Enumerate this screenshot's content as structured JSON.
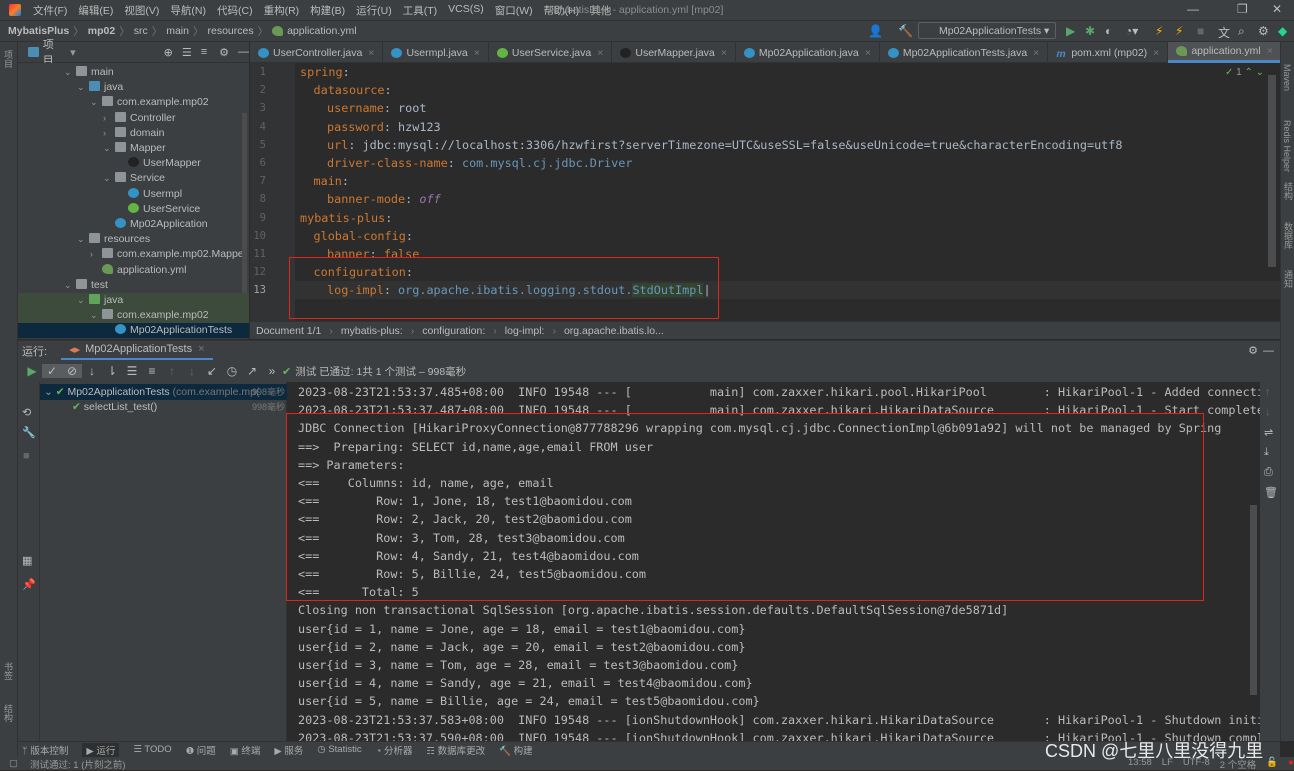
{
  "menubar": {
    "items": [
      "文件(F)",
      "编辑(E)",
      "视图(V)",
      "导航(N)",
      "代码(C)",
      "重构(R)",
      "构建(B)",
      "运行(U)",
      "工具(T)",
      "VCS(S)",
      "窗口(W)",
      "帮助(H)",
      "其他"
    ],
    "title": "MybatisPlus - application.yml [mp02]"
  },
  "navbar": {
    "crumbs": [
      "MybatisPlus",
      "mp02",
      "src",
      "main",
      "resources",
      "application.yml"
    ],
    "run_config": "Mp02ApplicationTests"
  },
  "project": {
    "title": "项目",
    "tree": [
      {
        "label": "main",
        "depth": 0,
        "arrow": "v",
        "icon": "folder"
      },
      {
        "label": "java",
        "depth": 1,
        "arrow": "v",
        "icon": "folderblue"
      },
      {
        "label": "com.example.mp02",
        "depth": 2,
        "arrow": "v",
        "icon": "folder"
      },
      {
        "label": "Controller",
        "depth": 3,
        "arrow": ">",
        "icon": "folder"
      },
      {
        "label": "domain",
        "depth": 3,
        "arrow": ">",
        "icon": "folder"
      },
      {
        "label": "Mapper",
        "depth": 3,
        "arrow": "v",
        "icon": "folder"
      },
      {
        "label": "UserMapper",
        "depth": 4,
        "arrow": "",
        "icon": "mapper"
      },
      {
        "label": "Service",
        "depth": 3,
        "arrow": "v",
        "icon": "folder"
      },
      {
        "label": "Usermpl",
        "depth": 4,
        "arrow": "",
        "icon": "cls"
      },
      {
        "label": "UserService",
        "depth": 4,
        "arrow": "",
        "icon": "intf"
      },
      {
        "label": "Mp02Application",
        "depth": 3,
        "arrow": "",
        "icon": "cls"
      },
      {
        "label": "resources",
        "depth": 1,
        "arrow": "v",
        "icon": "folder"
      },
      {
        "label": "com.example.mp02.Mapper",
        "depth": 2,
        "arrow": ">",
        "icon": "folder"
      },
      {
        "label": "application.yml",
        "depth": 2,
        "arrow": "",
        "icon": "yml"
      },
      {
        "label": "test",
        "depth": 0,
        "arrow": "v",
        "icon": "folder"
      },
      {
        "label": "java",
        "depth": 1,
        "arrow": "v",
        "icon": "foldergreen"
      },
      {
        "label": "com.example.mp02",
        "depth": 2,
        "arrow": "v",
        "icon": "folder"
      },
      {
        "label": "Mp02ApplicationTests",
        "depth": 3,
        "arrow": "",
        "icon": "cls",
        "selected": true
      }
    ]
  },
  "tabs": [
    {
      "label": "UserController.java",
      "icon": "cls"
    },
    {
      "label": "Usermpl.java",
      "icon": "cls"
    },
    {
      "label": "UserService.java",
      "icon": "intf"
    },
    {
      "label": "UserMapper.java",
      "icon": "mapper"
    },
    {
      "label": "Mp02Application.java",
      "icon": "cls"
    },
    {
      "label": "Mp02ApplicationTests.java",
      "icon": "cls"
    },
    {
      "label": "pom.xml (mp02)",
      "icon": "maven"
    },
    {
      "label": "application.yml",
      "icon": "yml",
      "active": true
    }
  ],
  "editor": {
    "inspection_count": "1",
    "lines": [
      {
        "n": "1",
        "indent": 0,
        "key": "spring",
        "val": "",
        "type": ""
      },
      {
        "n": "2",
        "indent": 1,
        "key": "datasource",
        "val": "",
        "type": ""
      },
      {
        "n": "3",
        "indent": 2,
        "key": "username",
        "val": "root",
        "type": "v"
      },
      {
        "n": "4",
        "indent": 2,
        "key": "password",
        "val": "hzw123",
        "type": "v"
      },
      {
        "n": "5",
        "indent": 2,
        "key": "url",
        "val": "jdbc:mysql://localhost:3306/hzwfirst?serverTimezone=UTC&useSSL=false&useUnicode=true&characterEncoding=utf8",
        "type": "v"
      },
      {
        "n": "6",
        "indent": 2,
        "key": "driver-class-name",
        "val": "com.mysql.cj.jdbc.Driver",
        "type": "c"
      },
      {
        "n": "7",
        "indent": 1,
        "key": "main",
        "val": "",
        "type": ""
      },
      {
        "n": "8",
        "indent": 2,
        "key": "banner-mode",
        "val": "off",
        "type": "it"
      },
      {
        "n": "9",
        "indent": 0,
        "key": "mybatis-plus",
        "val": "",
        "type": ""
      },
      {
        "n": "10",
        "indent": 1,
        "key": "global-config",
        "val": "",
        "type": ""
      },
      {
        "n": "11",
        "indent": 2,
        "key": "banner",
        "val": "false",
        "type": "k"
      },
      {
        "n": "12",
        "indent": 1,
        "key": "configuration",
        "val": "",
        "type": ""
      },
      {
        "n": "13",
        "indent": 2,
        "key": "log-impl",
        "val": "org.apache.ibatis.logging.stdout.",
        "val2": "StdOutImpl",
        "type": "c"
      }
    ],
    "breadcrumb": [
      "Document 1/1",
      "mybatis-plus:",
      "configuration:",
      "log-impl:",
      "org.apache.ibatis.lo..."
    ]
  },
  "run": {
    "label": "运行:",
    "tab": "Mp02ApplicationTests",
    "status": "测试 已通过: 1共 1 个测试 – 998毫秒",
    "tests": [
      {
        "name": "Mp02ApplicationTests",
        "pkg": "(com.example.mp(",
        "dur": "998毫秒"
      },
      {
        "name": "selectList_test()",
        "dur": "998毫秒"
      }
    ],
    "console": [
      "2023-08-23T21:53:37.485+08:00  INFO 19548 --- [           main] com.zaxxer.hikari.pool.HikariPool        : HikariPool-1 - Added connection com.mys",
      "2023-08-23T21:53:37.487+08:00  INFO 19548 --- [           main] com.zaxxer.hikari.HikariDataSource       : HikariPool-1 - Start completed.",
      "JDBC Connection [HikariProxyConnection@877788296 wrapping com.mysql.cj.jdbc.ConnectionImpl@6b091a92] will not be managed by Spring",
      "==>  Preparing: SELECT id,name,age,email FROM user",
      "==> Parameters: ",
      "<==    Columns: id, name, age, email",
      "<==        Row: 1, Jone, 18, test1@baomidou.com",
      "<==        Row: 2, Jack, 20, test2@baomidou.com",
      "<==        Row: 3, Tom, 28, test3@baomidou.com",
      "<==        Row: 4, Sandy, 21, test4@baomidou.com",
      "<==        Row: 5, Billie, 24, test5@baomidou.com",
      "<==      Total: 5",
      "Closing non transactional SqlSession [org.apache.ibatis.session.defaults.DefaultSqlSession@7de5871d]",
      "user{id = 1, name = Jone, age = 18, email = test1@baomidou.com}",
      "user{id = 2, name = Jack, age = 20, email = test2@baomidou.com}",
      "user{id = 3, name = Tom, age = 28, email = test3@baomidou.com}",
      "user{id = 4, name = Sandy, age = 21, email = test4@baomidou.com}",
      "user{id = 5, name = Billie, age = 24, email = test5@baomidou.com}",
      "2023-08-23T21:53:37.583+08:00  INFO 19548 --- [ionShutdownHook] com.zaxxer.hikari.HikariDataSource       : HikariPool-1 - Shutdown initiated...",
      "2023-08-23T21:53:37.590+08:00  INFO 19548 --- [ionShutdownHook] com.zaxxer.hikari.HikariDataSource       : HikariPool-1 - Shutdown completed."
    ]
  },
  "right_stripe": [
    "Maven",
    "Redis Helper",
    "结构",
    "数据库",
    "通知"
  ],
  "left_stripe": [
    "项目",
    "书签",
    "结构"
  ],
  "bottombar": [
    "版本控制",
    "运行",
    "TODO",
    "问题",
    "终端",
    "服务",
    "Statistic",
    "分析器",
    "数据库更改",
    "构建"
  ],
  "status": {
    "message": "测试通过: 1 (片刻之前)",
    "time": "13:58",
    "line_sep": "LF",
    "encoding": "UTF-8",
    "indent": "2 个空格"
  },
  "watermark": "CSDN @七里八里没得九里",
  "colors": {
    "key": "#cc7832",
    "string": "#a9b7c6",
    "highlight_box": "#e0241b",
    "pass": "#5fb85f",
    "accent": "#4a88c7"
  }
}
